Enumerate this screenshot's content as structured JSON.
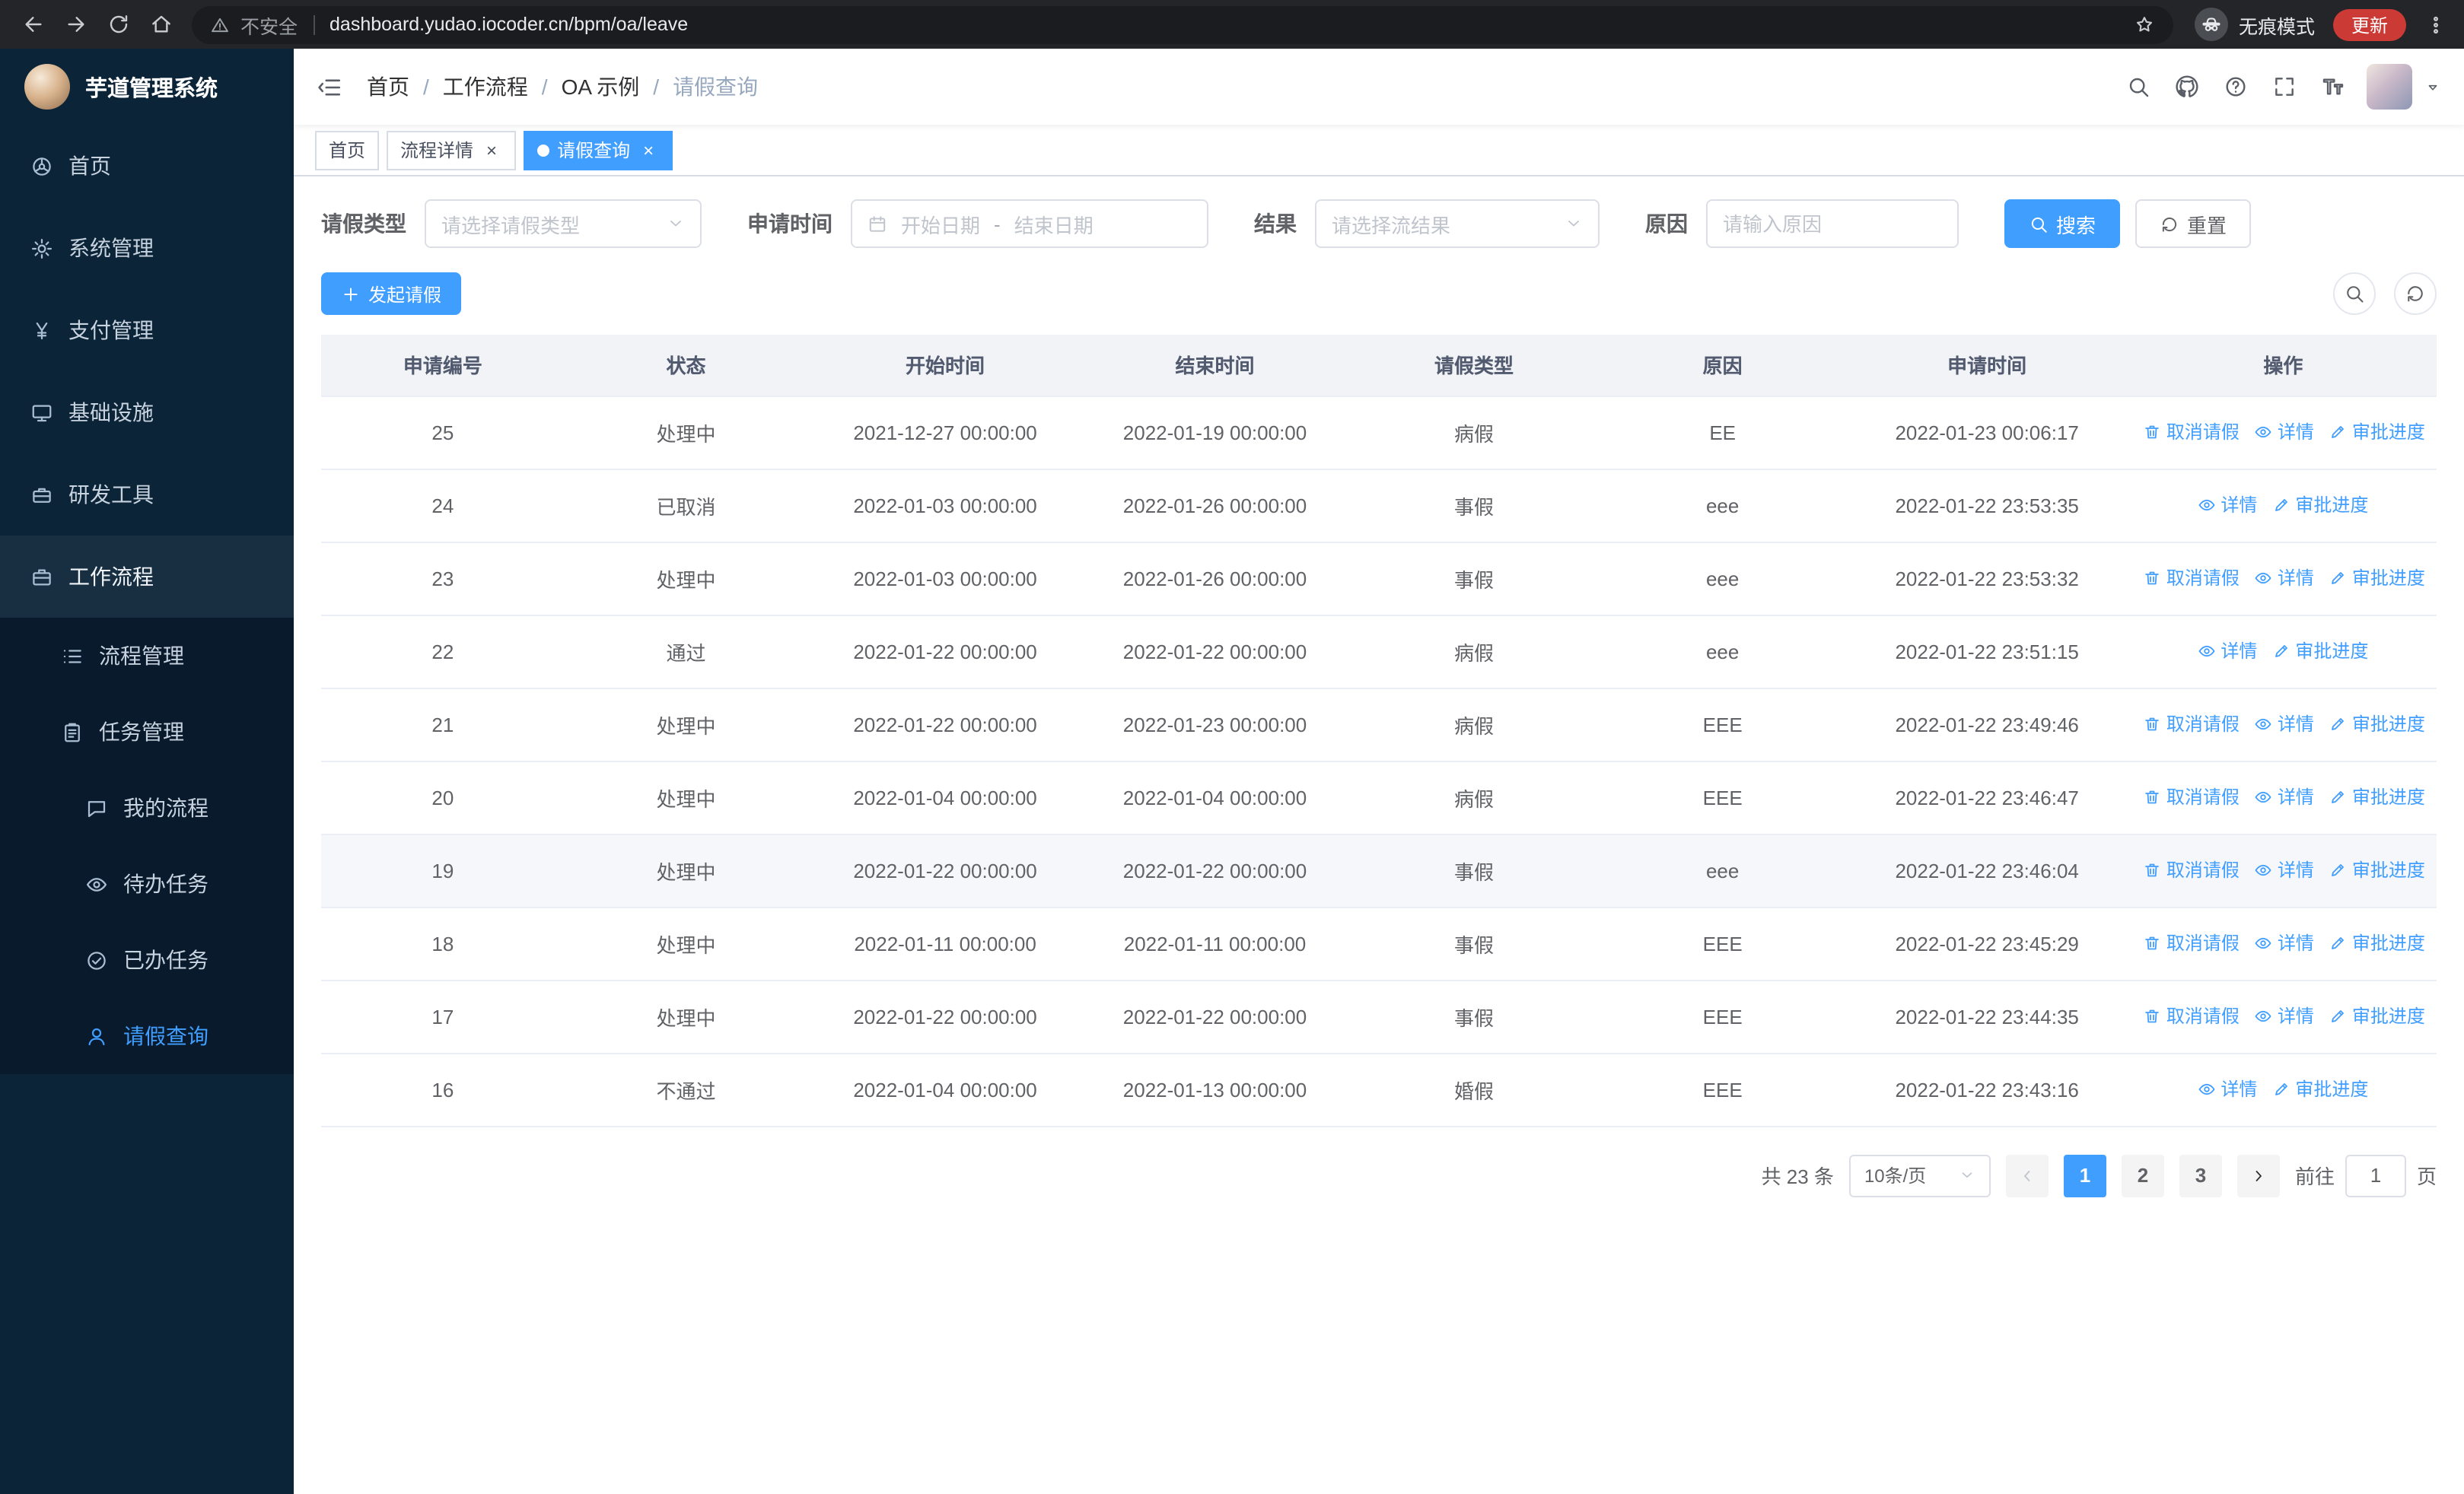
{
  "colors": {
    "primary": "#409eff",
    "sidebar_bg": "#0c2438",
    "sidebar_submenu_bg": "#081a2c"
  },
  "browser": {
    "nav_icons": [
      "back-icon",
      "forward-icon",
      "reload-icon",
      "home-icon"
    ],
    "security_label": "不安全",
    "url": "dashboard.yudao.iocoder.cn/bpm/oa/leave",
    "incognito_label": "无痕模式",
    "update_label": "更新"
  },
  "sidebar": {
    "logo_title": "芋道管理系统",
    "items": [
      {
        "label": "首页",
        "icon": "dashboard-icon",
        "level": 1
      },
      {
        "label": "系统管理",
        "icon": "gear-icon",
        "level": 1,
        "chevron": "down"
      },
      {
        "label": "支付管理",
        "icon": "yen-icon",
        "level": 1,
        "chevron": "down"
      },
      {
        "label": "基础设施",
        "icon": "monitor-icon",
        "level": 1,
        "chevron": "down"
      },
      {
        "label": "研发工具",
        "icon": "toolbox-icon",
        "level": 1,
        "chevron": "down"
      },
      {
        "label": "工作流程",
        "icon": "briefcase-icon",
        "level": 1,
        "chevron": "up"
      },
      {
        "label": "流程管理",
        "icon": "list-icon",
        "level": 2,
        "chevron": "down"
      },
      {
        "label": "任务管理",
        "icon": "clipboard-icon",
        "level": 2,
        "chevron": "up"
      },
      {
        "label": "我的流程",
        "icon": "chat-icon",
        "level": 3
      },
      {
        "label": "待办任务",
        "icon": "eye-icon",
        "level": 3
      },
      {
        "label": "已办任务",
        "icon": "check-icon",
        "level": 3
      },
      {
        "label": "请假查询",
        "icon": "user-icon",
        "level": 3,
        "active": true
      }
    ]
  },
  "header": {
    "breadcrumb": [
      {
        "label": "首页"
      },
      {
        "label": "工作流程"
      },
      {
        "label": "OA 示例"
      },
      {
        "label": "请假查询",
        "current": true
      }
    ],
    "icons": [
      "search-icon",
      "github-icon",
      "question-icon",
      "fullscreen-icon",
      "font-size-icon"
    ]
  },
  "tags": [
    {
      "label": "首页"
    },
    {
      "label": "流程详情",
      "closable": true
    },
    {
      "label": "请假查询",
      "closable": true,
      "active": true
    }
  ],
  "filters": {
    "leave_type_label": "请假类型",
    "leave_type_placeholder": "请选择请假类型",
    "apply_time_label": "申请时间",
    "start_date_placeholder": "开始日期",
    "date_separator": "-",
    "end_date_placeholder": "结束日期",
    "result_label": "结果",
    "result_placeholder": "请选择流结果",
    "reason_label": "原因",
    "reason_placeholder": "请输入原因",
    "search_label": "搜索",
    "reset_label": "重置"
  },
  "toolbar": {
    "create_label": "发起请假"
  },
  "table": {
    "columns": [
      "申请编号",
      "状态",
      "开始时间",
      "结束时间",
      "请假类型",
      "原因",
      "申请时间",
      "操作"
    ],
    "rows": [
      {
        "id": "25",
        "status": "处理中",
        "start_time": "2021-12-27 00:00:00",
        "end_time": "2022-01-19 00:00:00",
        "leave_type": "病假",
        "reason": "EE",
        "apply_time": "2022-01-23 00:06:17",
        "actions": [
          {
            "key": "cancel",
            "label": "取消请假"
          },
          {
            "key": "detail",
            "label": "详情"
          },
          {
            "key": "progress",
            "label": "审批进度"
          }
        ]
      },
      {
        "id": "24",
        "status": "已取消",
        "start_time": "2022-01-03 00:00:00",
        "end_time": "2022-01-26 00:00:00",
        "leave_type": "事假",
        "reason": "eee",
        "apply_time": "2022-01-22 23:53:35",
        "actions": [
          {
            "key": "detail",
            "label": "详情"
          },
          {
            "key": "progress",
            "label": "审批进度"
          }
        ]
      },
      {
        "id": "23",
        "status": "处理中",
        "start_time": "2022-01-03 00:00:00",
        "end_time": "2022-01-26 00:00:00",
        "leave_type": "事假",
        "reason": "eee",
        "apply_time": "2022-01-22 23:53:32",
        "actions": [
          {
            "key": "cancel",
            "label": "取消请假"
          },
          {
            "key": "detail",
            "label": "详情"
          },
          {
            "key": "progress",
            "label": "审批进度"
          }
        ]
      },
      {
        "id": "22",
        "status": "通过",
        "start_time": "2022-01-22 00:00:00",
        "end_time": "2022-01-22 00:00:00",
        "leave_type": "病假",
        "reason": "eee",
        "apply_time": "2022-01-22 23:51:15",
        "actions": [
          {
            "key": "detail",
            "label": "详情"
          },
          {
            "key": "progress",
            "label": "审批进度"
          }
        ]
      },
      {
        "id": "21",
        "status": "处理中",
        "start_time": "2022-01-22 00:00:00",
        "end_time": "2022-01-23 00:00:00",
        "leave_type": "病假",
        "reason": "EEE",
        "apply_time": "2022-01-22 23:49:46",
        "actions": [
          {
            "key": "cancel",
            "label": "取消请假"
          },
          {
            "key": "detail",
            "label": "详情"
          },
          {
            "key": "progress",
            "label": "审批进度"
          }
        ]
      },
      {
        "id": "20",
        "status": "处理中",
        "start_time": "2022-01-04 00:00:00",
        "end_time": "2022-01-04 00:00:00",
        "leave_type": "病假",
        "reason": "EEE",
        "apply_time": "2022-01-22 23:46:47",
        "actions": [
          {
            "key": "cancel",
            "label": "取消请假"
          },
          {
            "key": "detail",
            "label": "详情"
          },
          {
            "key": "progress",
            "label": "审批进度"
          }
        ]
      },
      {
        "id": "19",
        "status": "处理中",
        "start_time": "2022-01-22 00:00:00",
        "end_time": "2022-01-22 00:00:00",
        "leave_type": "事假",
        "reason": "eee",
        "apply_time": "2022-01-22 23:46:04",
        "highlighted": true,
        "actions": [
          {
            "key": "cancel",
            "label": "取消请假"
          },
          {
            "key": "detail",
            "label": "详情"
          },
          {
            "key": "progress",
            "label": "审批进度"
          }
        ]
      },
      {
        "id": "18",
        "status": "处理中",
        "start_time": "2022-01-11 00:00:00",
        "end_time": "2022-01-11 00:00:00",
        "leave_type": "事假",
        "reason": "EEE",
        "apply_time": "2022-01-22 23:45:29",
        "actions": [
          {
            "key": "cancel",
            "label": "取消请假"
          },
          {
            "key": "detail",
            "label": "详情"
          },
          {
            "key": "progress",
            "label": "审批进度"
          }
        ]
      },
      {
        "id": "17",
        "status": "处理中",
        "start_time": "2022-01-22 00:00:00",
        "end_time": "2022-01-22 00:00:00",
        "leave_type": "事假",
        "reason": "EEE",
        "apply_time": "2022-01-22 23:44:35",
        "actions": [
          {
            "key": "cancel",
            "label": "取消请假"
          },
          {
            "key": "detail",
            "label": "详情"
          },
          {
            "key": "progress",
            "label": "审批进度"
          }
        ]
      },
      {
        "id": "16",
        "status": "不通过",
        "start_time": "2022-01-04 00:00:00",
        "end_time": "2022-01-13 00:00:00",
        "leave_type": "婚假",
        "reason": "EEE",
        "apply_time": "2022-01-22 23:43:16",
        "actions": [
          {
            "key": "detail",
            "label": "详情"
          },
          {
            "key": "progress",
            "label": "审批进度"
          }
        ]
      }
    ]
  },
  "pagination": {
    "total_label": "共 23 条",
    "page_size_label": "10条/页",
    "pages": [
      "1",
      "2",
      "3"
    ],
    "active_page": "1",
    "goto_prefix": "前往",
    "goto_value": "1",
    "goto_suffix": "页"
  }
}
